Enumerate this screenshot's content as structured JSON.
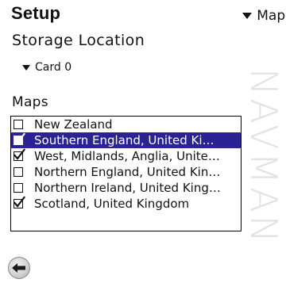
{
  "header": {
    "title": "Setup",
    "view_selector": "Maps"
  },
  "storage": {
    "label": "Storage Location",
    "selected": "Card 0"
  },
  "maps": {
    "label": "Maps",
    "items": [
      {
        "label": "New Zealand",
        "checked": false,
        "selected": false
      },
      {
        "label": "Southern England, United Kingdom",
        "checked": true,
        "selected": true
      },
      {
        "label": "West, Midlands, Anglia, United Kingdom",
        "checked": true,
        "selected": false
      },
      {
        "label": "Northern England, United Kingdom",
        "checked": false,
        "selected": false
      },
      {
        "label": "Northern Ireland, United Kingdom",
        "checked": false,
        "selected": false
      },
      {
        "label": "Scotland, United Kingdom",
        "checked": true,
        "selected": false
      }
    ]
  },
  "watermark": "NAVMAN",
  "navigation": {
    "back_icon": "back-arrow-icon"
  },
  "colors": {
    "selection_background": "#2b2394",
    "selection_text": "#ffffff",
    "watermark": "#e2e2e2"
  }
}
